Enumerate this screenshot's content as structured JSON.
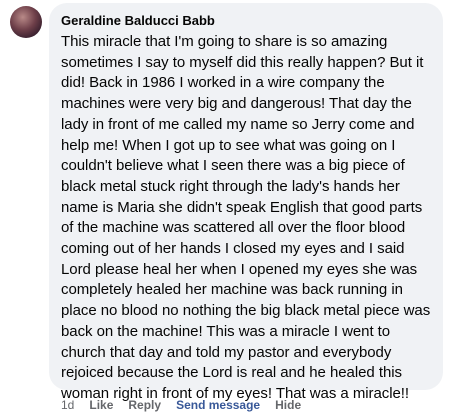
{
  "comment": {
    "author": "Geraldine Balducci Babb",
    "text": "This miracle that I'm going to share is so amazing sometimes I say to myself did this really happen? But it did! Back in 1986 I worked in a wire company the machines were very big and dangerous! That day the lady in front of me called my name so Jerry come and help me! When I got up to see what was going on I couldn't believe what I seen there was a big piece of black metal stuck right through the lady's hands her name is Maria she didn't speak English that good parts of the machine was scattered all over the floor blood coming out of her hands I closed my eyes and I said Lord please heal her when I opened my eyes she was completely healed her machine was back running in place no blood no nothing the big black metal piece was back on the machine! This was a miracle I went to church that day and told my pastor and everybody rejoiced because the Lord is real and he healed this woman right in front of my eyes! That was a miracle!!"
  },
  "actions": {
    "time": "1d",
    "like": "Like",
    "reply": "Reply",
    "send_message": "Send message",
    "hide": "Hide"
  },
  "colors": {
    "bubble_bg": "#f0f2f5",
    "text": "#050505",
    "secondary": "#65676b",
    "link": "#385898"
  }
}
